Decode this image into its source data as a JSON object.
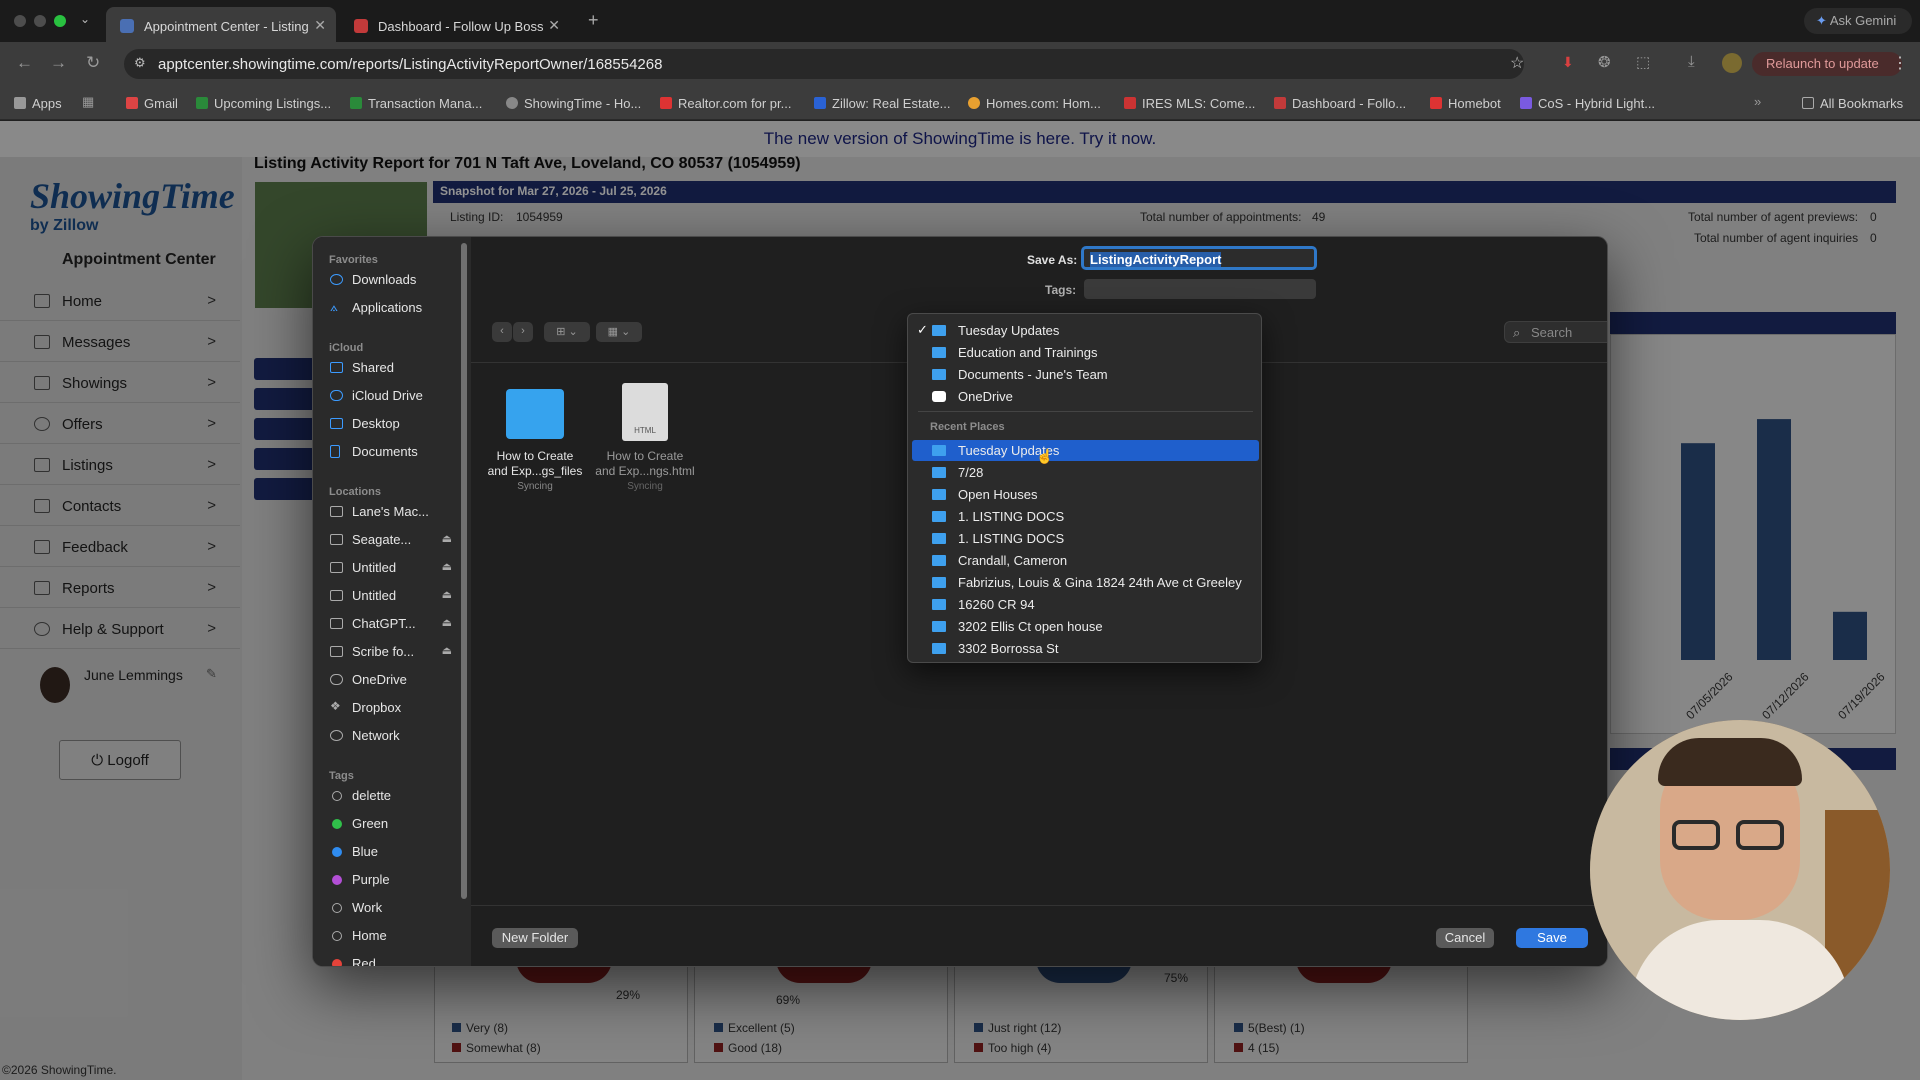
{
  "browser": {
    "tabs": [
      {
        "label": "Appointment Center - Listing",
        "active": true
      },
      {
        "label": "Dashboard - Follow Up Boss",
        "active": false
      }
    ],
    "url": "apptcenter.showingtime.com/reports/ListingActivityReportOwner/168554268",
    "ask_gemini": "Ask Gemini",
    "relaunch": "Relaunch to update",
    "bookmarks": [
      "Apps",
      "Gmail",
      "Upcoming Listings...",
      "Transaction Mana...",
      "ShowingTime - Ho...",
      "Realtor.com for pr...",
      "Zillow: Real Estate...",
      "Homes.com: Hom...",
      "IRES MLS: Come...",
      "Dashboard - Follo...",
      "Homebot",
      "CoS - Hybrid Light..."
    ],
    "all_bookmarks": "All Bookmarks"
  },
  "page": {
    "banner": "The new version of ShowingTime is here. Try it now.",
    "logo": {
      "name": "ShowingTime",
      "by": "by",
      "brand": "Zillow"
    },
    "app_title": "Appointment Center",
    "nav": [
      "Home",
      "Messages",
      "Showings",
      "Offers",
      "Listings",
      "Contacts",
      "Feedback",
      "Reports",
      "Help & Support"
    ],
    "user": "June Lemmings",
    "logoff": "Logoff",
    "report_title": "Listing Activity Report for 701 N Taft Ave, Loveland, CO 80537 (1054959)",
    "snapshot": "Snapshot for Mar 27, 2026 - Jul 25, 2026",
    "listing_id_label": "Listing ID:",
    "listing_id": "1054959",
    "total_appts_label": "Total number of appointments:",
    "total_appts": "49",
    "agent_previews_label": "Total number of agent previews:",
    "agent_previews": "0",
    "agent_inquiries_label": "Total number of agent inquiries",
    "agent_inquiries": "0",
    "footer": "©2026 ShowingTime.",
    "pie_labels": [
      "29%",
      "69%",
      "75%"
    ],
    "legends": [
      [
        {
          "label": "Very (8)",
          "color": "#2e4f7f"
        },
        {
          "label": "Somewhat (8)",
          "color": "#8b1f1f"
        }
      ],
      [
        {
          "label": "Excellent (5)",
          "color": "#2e4f7f"
        },
        {
          "label": "Good (18)",
          "color": "#8b1f1f"
        }
      ],
      [
        {
          "label": "Just right (12)",
          "color": "#2e4f7f"
        },
        {
          "label": "Too high (4)",
          "color": "#8b1f1f"
        }
      ],
      [
        {
          "label": "5(Best) (1)",
          "color": "#2e4f7f"
        },
        {
          "label": "4 (15)",
          "color": "#8b1f1f"
        }
      ]
    ]
  },
  "chart_data": {
    "type": "bar",
    "categories": [
      "07/05/2026",
      "07/12/2026",
      "07/19/2026"
    ],
    "values": [
      9,
      10,
      2
    ],
    "ylim": [
      0,
      11
    ],
    "title": "",
    "xlabel": "",
    "ylabel": ""
  },
  "dialog": {
    "save_as_label": "Save As:",
    "save_as_value": "ListingActivityReport",
    "tags_label": "Tags:",
    "search_placeholder": "Search",
    "favorites_header": "Favorites",
    "favorites": [
      "Downloads",
      "Applications"
    ],
    "icloud_header": "iCloud",
    "icloud": [
      "Shared",
      "iCloud Drive",
      "Desktop",
      "Documents"
    ],
    "locations_header": "Locations",
    "locations": [
      "Lane's Mac...",
      "Seagate...",
      "Untitled",
      "Untitled",
      "ChatGPT...",
      "Scribe fo...",
      "OneDrive",
      "Dropbox",
      "Network"
    ],
    "tags_header": "Tags",
    "tags": [
      {
        "label": "delette",
        "color": ""
      },
      {
        "label": "Green",
        "color": "#30c04a"
      },
      {
        "label": "Blue",
        "color": "#2f8cf0"
      },
      {
        "label": "Purple",
        "color": "#b34fd6"
      },
      {
        "label": "Work",
        "color": ""
      },
      {
        "label": "Home",
        "color": ""
      },
      {
        "label": "Red",
        "color": "#e5433a"
      }
    ],
    "files": [
      {
        "name1": "How to Create",
        "name2": "and Exp...gs_files",
        "status": "Syncing"
      },
      {
        "name1": "How to Create",
        "name2": "and Exp...ngs.html",
        "status": "Syncing"
      }
    ],
    "new_folder": "New Folder",
    "cancel": "Cancel",
    "save": "Save",
    "popup": {
      "top": [
        "Tuesday Updates",
        "Education and Trainings",
        "Documents - June's Team",
        "OneDrive"
      ],
      "recent_header": "Recent Places",
      "recent": [
        "Tuesday Updates",
        "7/28",
        "Open Houses",
        "1. LISTING DOCS",
        "1. LISTING DOCS",
        "Crandall, Cameron",
        "Fabrizius, Louis & Gina 1824 24th Ave ct Greeley",
        "16260 CR 94",
        "3202 Ellis Ct open house",
        "3302 Borrossa St"
      ]
    }
  }
}
